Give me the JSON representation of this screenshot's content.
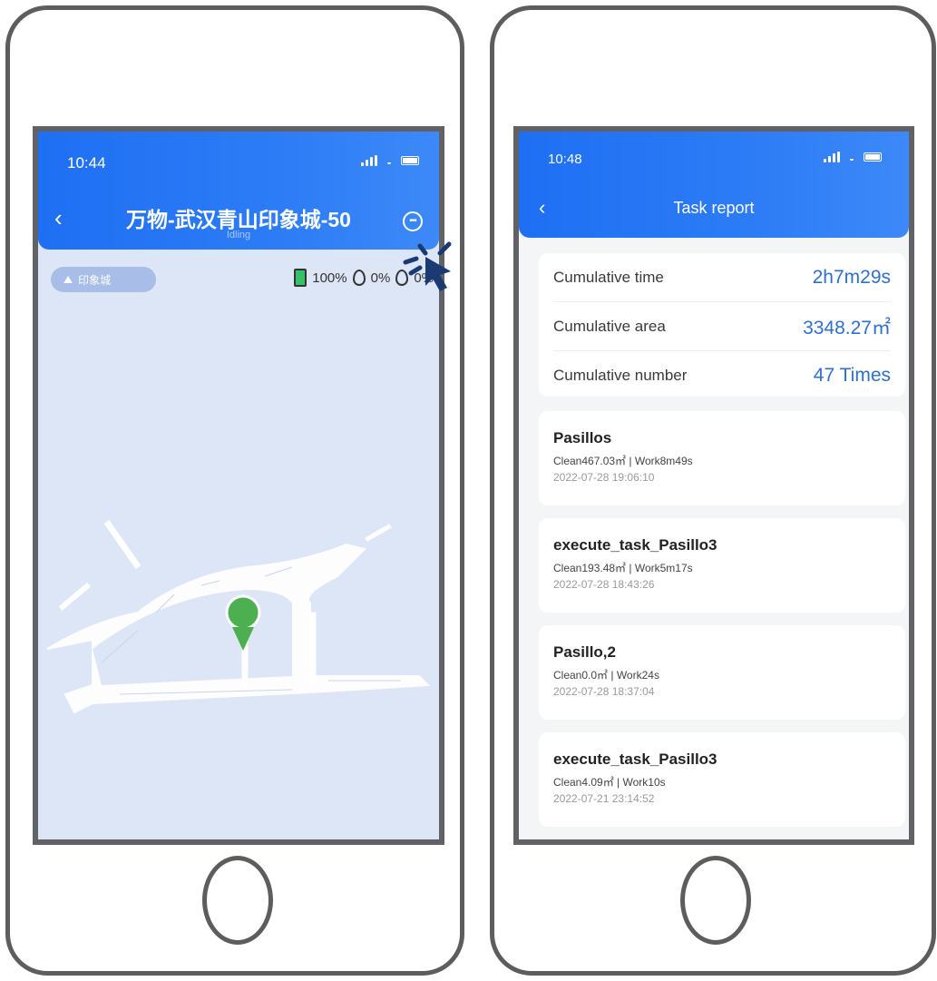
{
  "left_phone": {
    "status_time": "10:44",
    "title": "万物-武汉青山印象城-50",
    "subtitle": "Idling",
    "map_tag": "印象城",
    "battery": "100%",
    "water_clean": "0%",
    "water_dirty": "0%",
    "colors": {
      "header": "#2d7cf6",
      "map_bg": "#dde6f7",
      "pin": "#4caf50"
    }
  },
  "right_phone": {
    "status_time": "10:48",
    "title": "Task report",
    "summary": [
      {
        "label": "Cumulative time",
        "value": "2h7m29s"
      },
      {
        "label": "Cumulative area",
        "value": "3348.27㎡"
      },
      {
        "label": "Cumulative number",
        "value": "47 Times"
      }
    ],
    "tasks": [
      {
        "name": "Pasillos",
        "meta": "Clean467.03㎡ | Work8m49s",
        "date": "2022-07-28 19:06:10"
      },
      {
        "name": "execute_task_Pasillo3",
        "meta": "Clean193.48㎡ | Work5m17s",
        "date": "2022-07-28 18:43:26"
      },
      {
        "name": "Pasillo,2",
        "meta": "Clean0.0㎡ | Work24s",
        "date": "2022-07-28 18:37:04"
      },
      {
        "name": "execute_task_Pasillo3",
        "meta": "Clean4.09㎡ | Work10s",
        "date": "2022-07-21 23:14:52"
      }
    ]
  }
}
